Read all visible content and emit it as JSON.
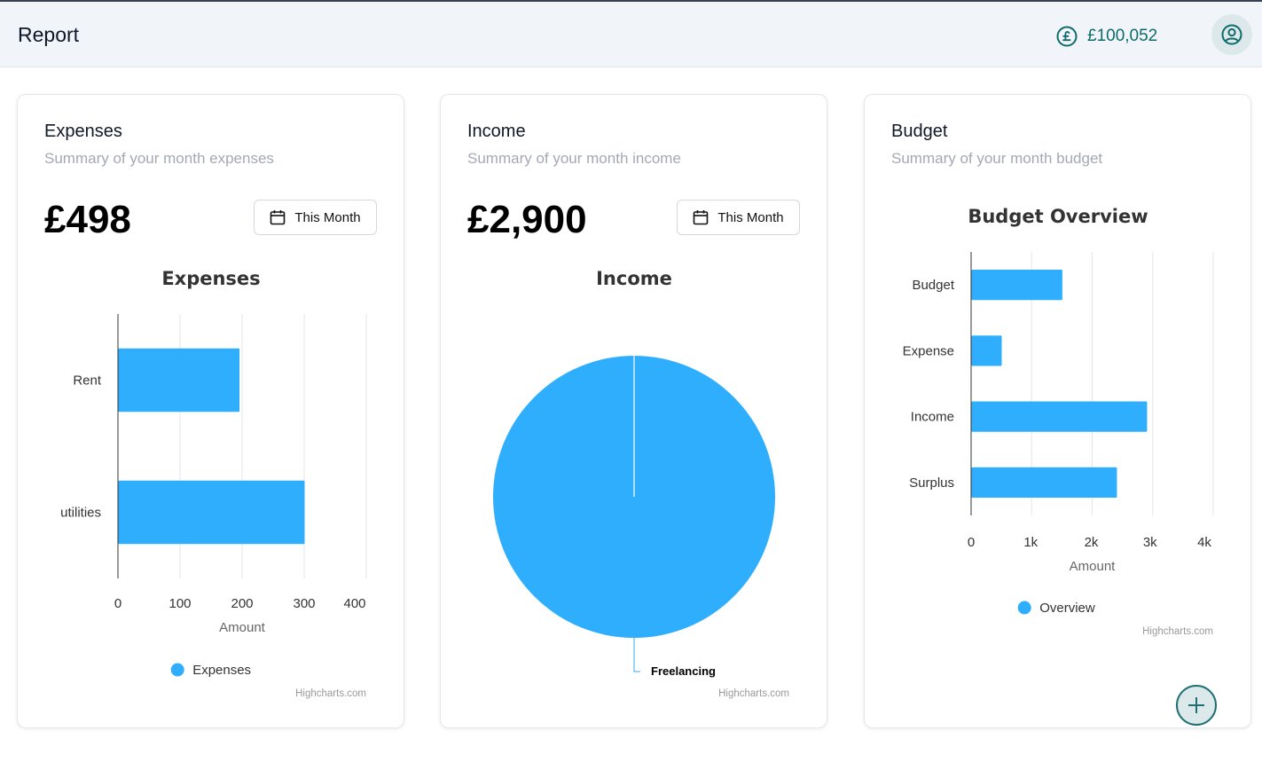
{
  "header": {
    "title": "Report",
    "balance": "£100,052",
    "balance_icon": "pound-coin-icon",
    "avatar_icon": "user-circle-icon"
  },
  "colors": {
    "accent": "#2eaefc",
    "teal": "#0f6b6b"
  },
  "cards": {
    "expenses": {
      "title": "Expenses",
      "subtitle": "Summary of your month expenses",
      "amount": "£498",
      "filter_label": "This Month"
    },
    "income": {
      "title": "Income",
      "subtitle": "Summary of your month income",
      "amount": "£2,900",
      "filter_label": "This Month"
    },
    "budget": {
      "title": "Budget",
      "subtitle": "Summary of your month budget"
    }
  },
  "chart_data": [
    {
      "id": "expenses",
      "type": "bar",
      "orientation": "horizontal",
      "title": "Expenses",
      "xlabel": "Amount",
      "categories": [
        "Rent",
        "utilities"
      ],
      "series": [
        {
          "name": "Expenses",
          "values": [
            195,
            300
          ]
        }
      ],
      "xlim": [
        0,
        400
      ],
      "ticks": [
        "0",
        "100",
        "200",
        "300",
        "400"
      ],
      "grid": true,
      "legend": "bottom",
      "credits": "Highcharts.com"
    },
    {
      "id": "income",
      "type": "pie",
      "title": "Income",
      "slices": [
        {
          "label": "Freelancing",
          "value": 2900
        }
      ],
      "credits": "Highcharts.com"
    },
    {
      "id": "budget",
      "type": "bar",
      "orientation": "horizontal",
      "title": "Budget Overview",
      "xlabel": "Amount",
      "categories": [
        "Budget",
        "Expense",
        "Income",
        "Surplus"
      ],
      "series": [
        {
          "name": "Overview",
          "values": [
            1500,
            498,
            2900,
            2402
          ]
        }
      ],
      "xlim": [
        0,
        4000
      ],
      "ticks": [
        "0",
        "1k",
        "2k",
        "3k",
        "4k"
      ],
      "grid": true,
      "legend": "bottom",
      "credits": "Highcharts.com"
    }
  ],
  "fab": {
    "icon": "plus-icon"
  }
}
